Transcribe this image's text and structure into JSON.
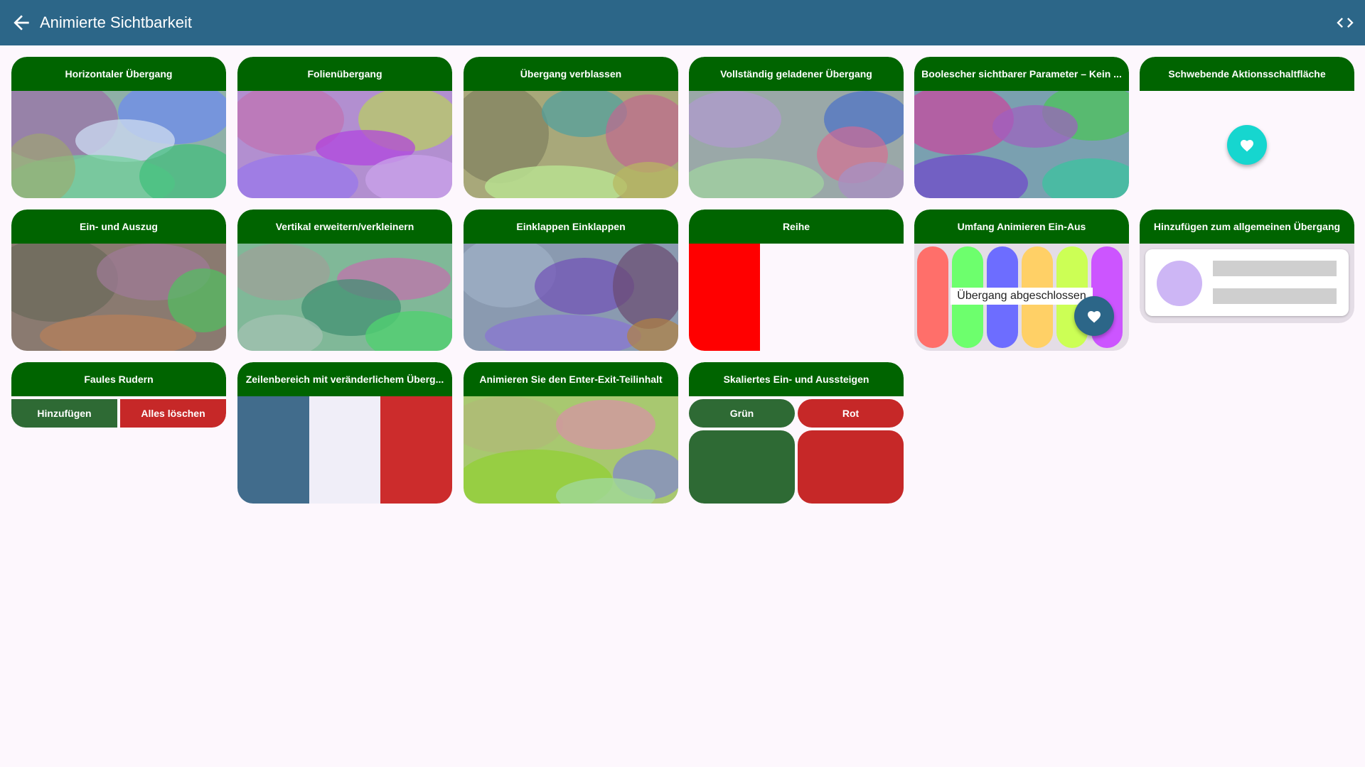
{
  "topbar": {
    "title": "Animierte Sichtbarkeit",
    "back_icon": "arrow-back-icon",
    "code_icon": "code-icon",
    "color": "#2c6688"
  },
  "colors": {
    "card_header": "#006400",
    "background": "#fdf7fd"
  },
  "cards": [
    {
      "title": "Horizontaler Übergang"
    },
    {
      "title": "Folienübergang"
    },
    {
      "title": "Übergang verblassen"
    },
    {
      "title": "Vollständig geladener Übergang"
    },
    {
      "title": "Boolescher sichtbarer Parameter – Kein ..."
    },
    {
      "title": "Schwebende Aktionsschaltfläche",
      "fab_icon": "heart-icon",
      "fab_color": "#16d6cf"
    },
    {
      "title": "Ein- und Auszug"
    },
    {
      "title": "Vertikal erweitern/verkleinern"
    },
    {
      "title": "Einklappen Einklappen"
    },
    {
      "title": "Reihe",
      "block_color": "#ff0000"
    },
    {
      "title": "Umfang Animieren Ein-Aus",
      "label": "Übergang abgeschlossen",
      "pill_colors": [
        "#ff6f6a",
        "#6dff6d",
        "#6d6dff",
        "#ffd066",
        "#ccff55",
        "#cc55ff"
      ],
      "fab_icon": "heart-icon",
      "fab_color": "#2c6688"
    },
    {
      "title": "Hinzufügen zum allgemeinen Übergang",
      "avatar_color": "#cdb6f5"
    },
    {
      "title": "Faules Rudern",
      "buttons": [
        "Hinzufügen",
        "Alles löschen"
      ],
      "button_colors": [
        "#2e6a34",
        "#c62828"
      ]
    },
    {
      "title": "Zeilenbereich mit veränderlichem Überg...",
      "stripe_colors": [
        "#416c8c",
        "#f0eef8",
        "#cc2c2c"
      ]
    },
    {
      "title": "Animieren Sie den Enter-Exit-Teilinhalt"
    },
    {
      "title": "Skaliertes Ein- und Aussteigen",
      "buttons": [
        "Grün",
        "Rot"
      ],
      "button_colors": [
        "#2e6a34",
        "#c62828"
      ]
    }
  ]
}
